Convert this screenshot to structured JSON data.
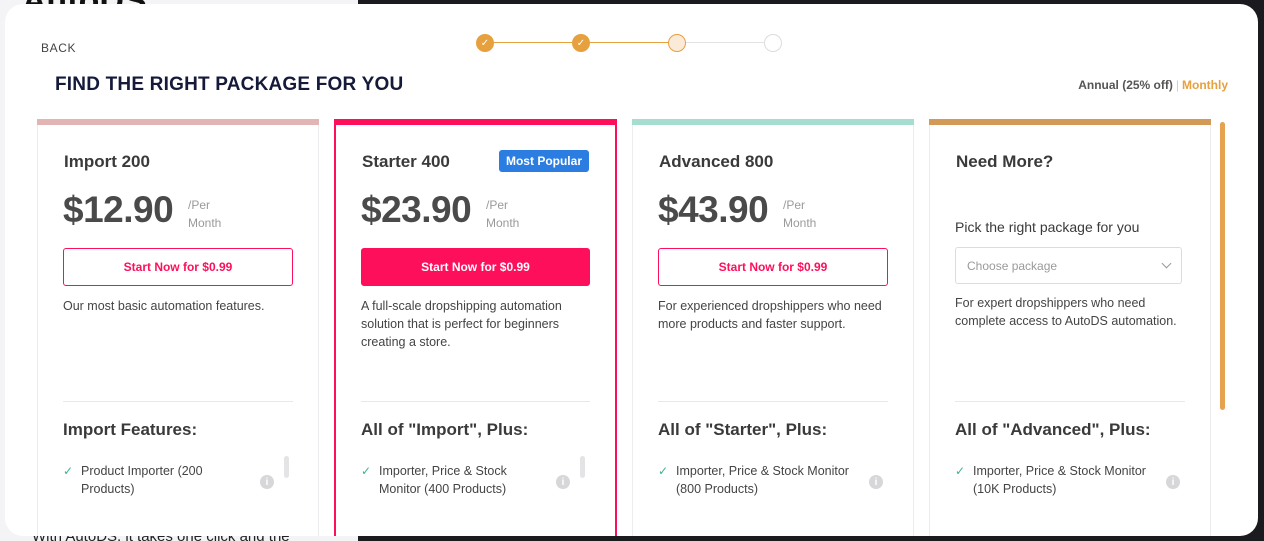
{
  "background": {
    "top_text": "AutoDS",
    "bottom_text": "With AutoDS, it takes one click and the"
  },
  "nav": {
    "back_label": "BACK"
  },
  "stepper": {
    "steps": [
      {
        "state": "done"
      },
      {
        "state": "done"
      },
      {
        "state": "current"
      },
      {
        "state": "pending"
      }
    ],
    "check_glyph": "✓"
  },
  "header": {
    "title": "FIND THE RIGHT PACKAGE FOR YOU",
    "billing_annual": "Annual (25% off)",
    "billing_separator": "|",
    "billing_monthly": "Monthly"
  },
  "colors": {
    "accent_pink": "#fd0f5c",
    "accent_orange": "#e7a03e",
    "badge_blue": "#2b7de1",
    "check_green": "#3bb58a"
  },
  "plans": [
    {
      "name": "Import 200",
      "price": "$12.90",
      "per_line1": "/Per",
      "per_line2": "Month",
      "cta": "Start Now for $0.99",
      "description": "Our most basic automation features.",
      "features_heading": "Import Features:",
      "feature_1": "Product Importer (200 Products)",
      "accent": "#e2b4b4"
    },
    {
      "name": "Starter 400",
      "badge": "Most Popular",
      "price": "$23.90",
      "per_line1": "/Per",
      "per_line2": "Month",
      "cta": "Start Now for $0.99",
      "description": "A full-scale dropshipping automation solution that is perfect for beginners creating a store.",
      "features_heading": "All of \"Import\", Plus:",
      "feature_1": "Importer, Price & Stock Monitor (400 Products)",
      "accent": "#fd0f5c"
    },
    {
      "name": "Advanced 800",
      "price": "$43.90",
      "per_line1": "/Per",
      "per_line2": "Month",
      "cta": "Start Now for $0.99",
      "description": "For experienced dropshippers who need more products and faster support.",
      "features_heading": "All of \"Starter\", Plus:",
      "feature_1": "Importer, Price & Stock Monitor (800 Products)",
      "accent": "#a6ddd1"
    },
    {
      "name": "Need More?",
      "pick_label": "Pick the right package for you",
      "select_placeholder": "Choose package",
      "description": "For expert dropshippers who need complete access to AutoDS automation.",
      "features_heading": "All of \"Advanced\", Plus:",
      "feature_1": "Importer, Price & Stock Monitor (10K Products)",
      "accent": "#d39a57"
    }
  ],
  "icons": {
    "check": "✓",
    "info": "i"
  }
}
